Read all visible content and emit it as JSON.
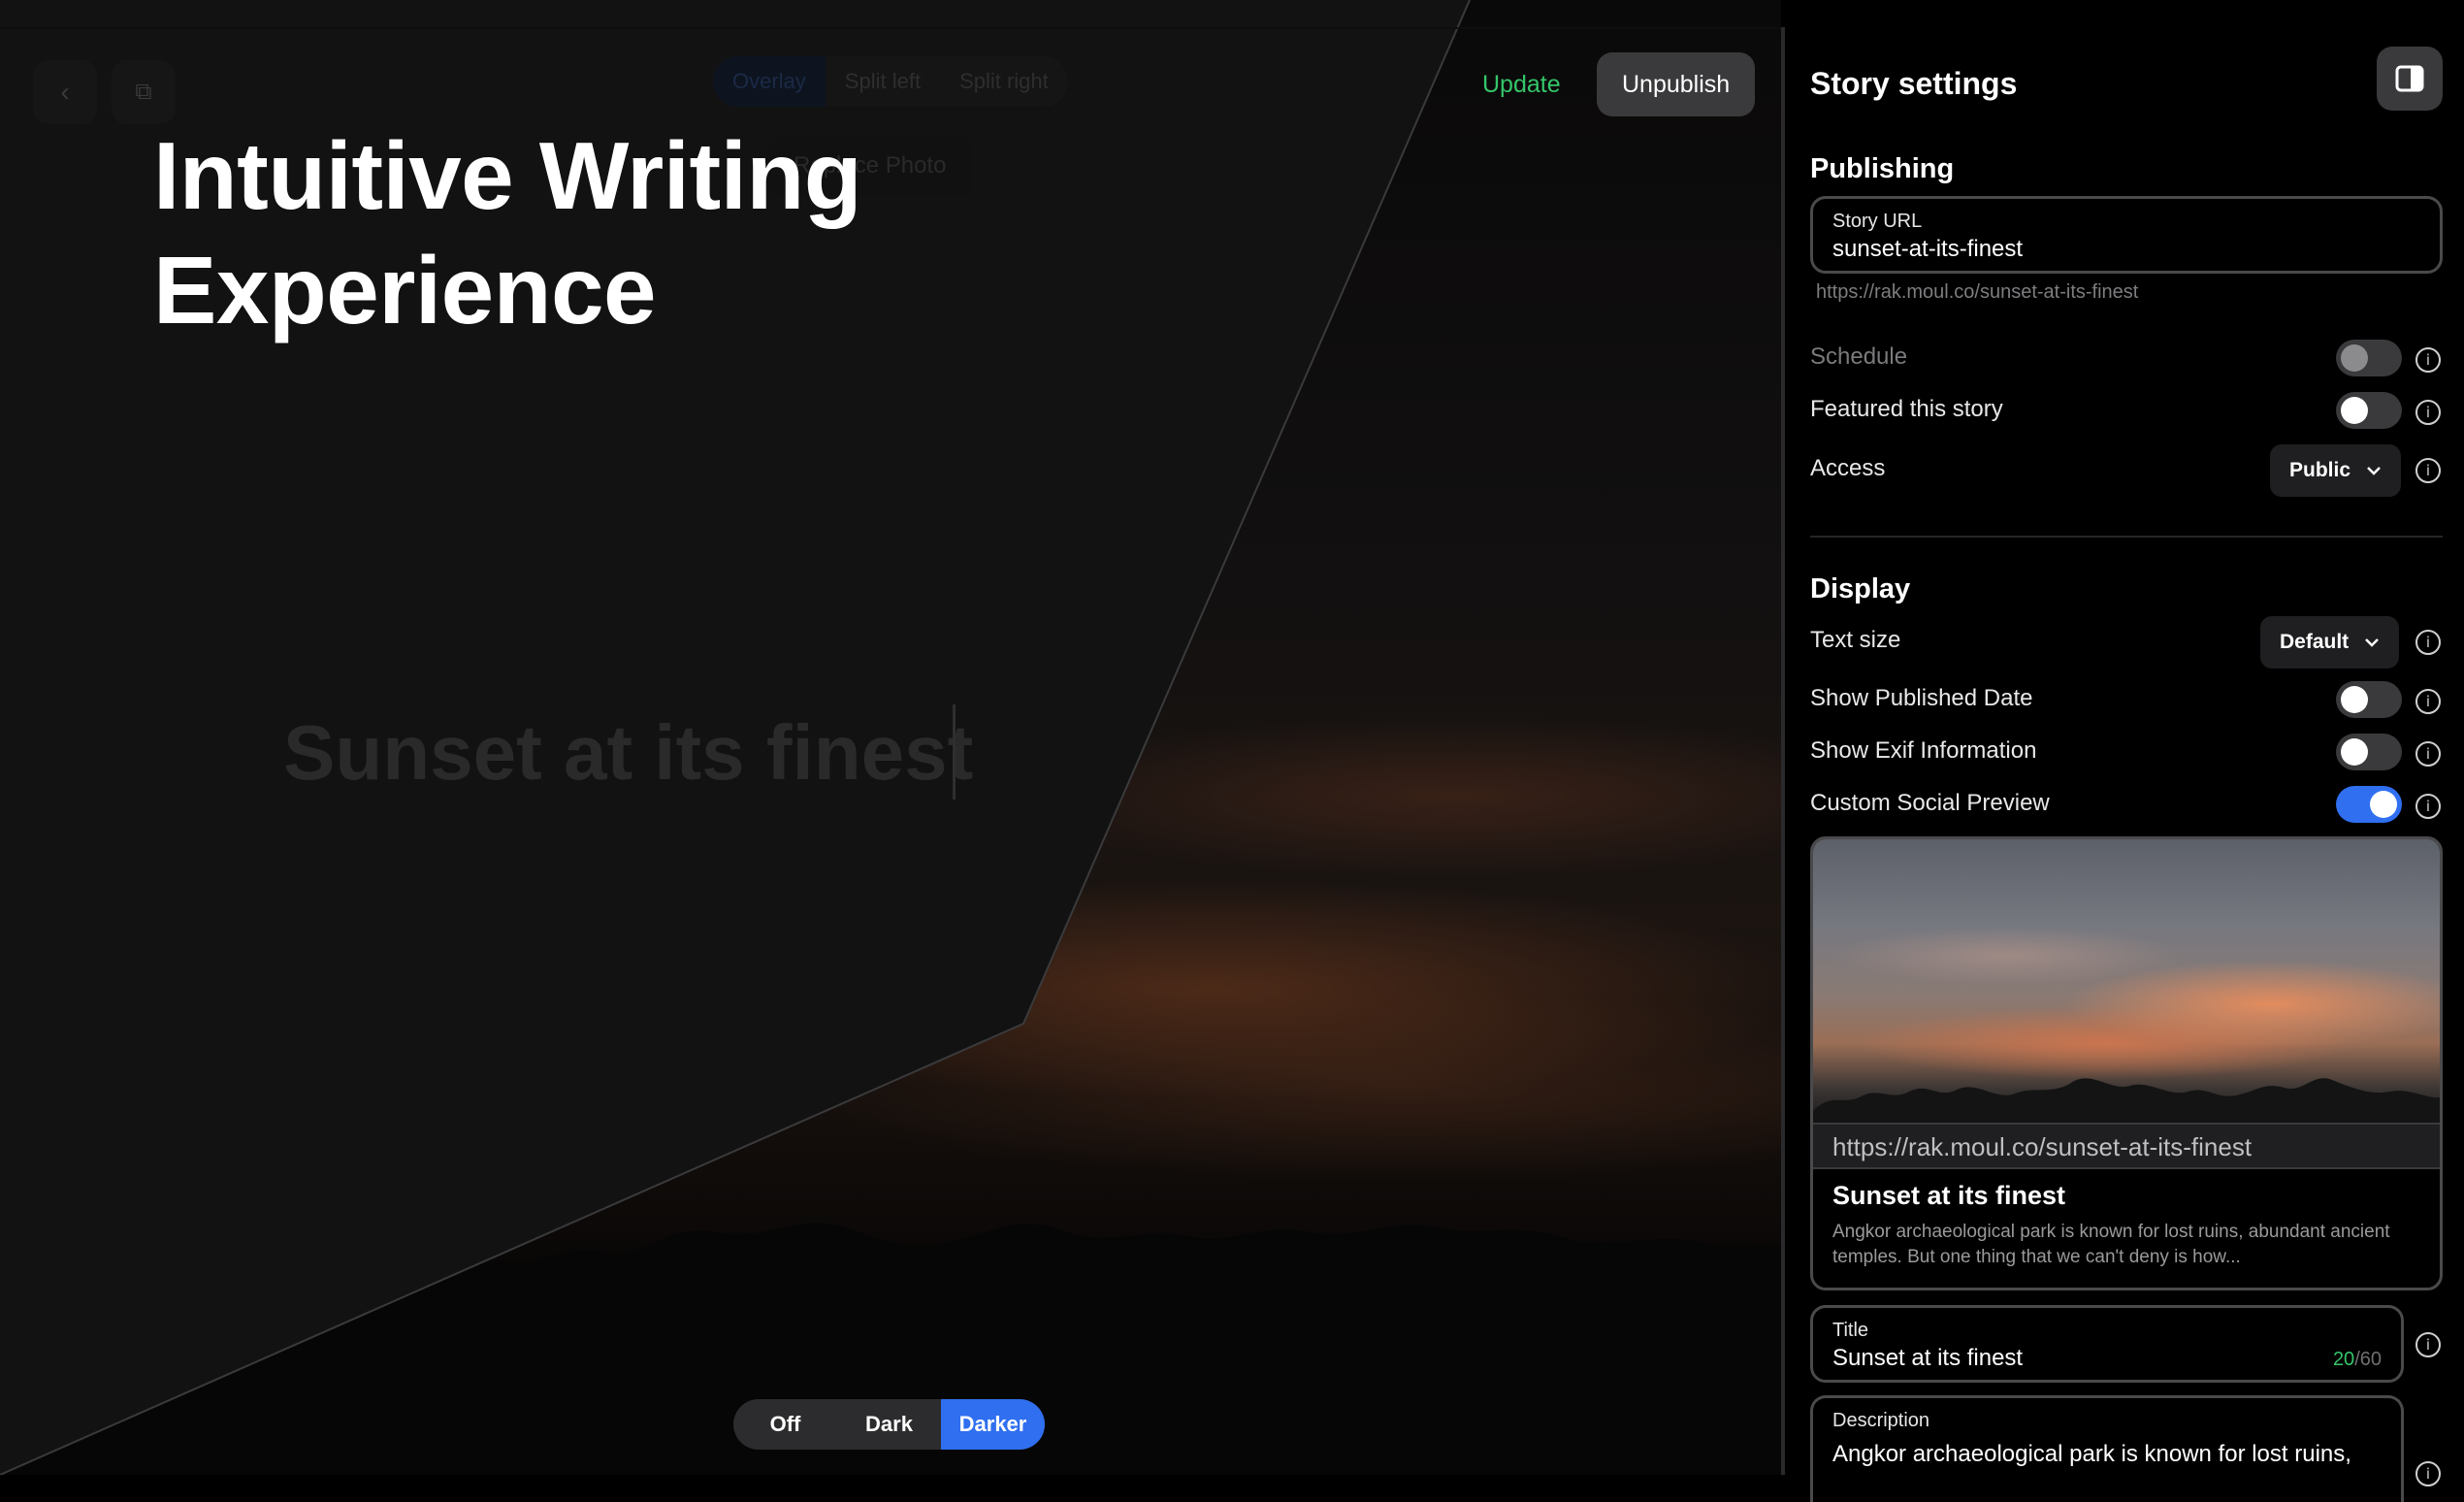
{
  "editor": {
    "layout_options": [
      "Overlay",
      "Split left",
      "Split right"
    ],
    "replace_photo_label": "Replace Photo",
    "hero_title_line1": "Intuitive Writing",
    "hero_title_line2": "Experience",
    "story_title": "Sunset at its finest",
    "update_label": "Update",
    "unpublish_label": "Unpublish",
    "dim_options": [
      "Off",
      "Dark",
      "Darker"
    ],
    "dim_selected": "Darker"
  },
  "settings": {
    "title": "Story settings",
    "publishing": {
      "heading": "Publishing",
      "url_label": "Story URL",
      "url_value": "sunset-at-its-finest",
      "url_hint": "https://rak.moul.co/sunset-at-its-finest",
      "schedule_label": "Schedule",
      "featured_label": "Featured this story",
      "access_label": "Access",
      "access_value": "Public"
    },
    "display": {
      "heading": "Display",
      "text_size_label": "Text size",
      "text_size_value": "Default",
      "published_date_label": "Show Published Date",
      "exif_label": "Show Exif Information",
      "social_preview_label": "Custom Social Preview"
    },
    "social_preview": {
      "url": "https://rak.moul.co/sunset-at-its-finest",
      "title": "Sunset at its finest",
      "description": "Angkor archaeological park is known for lost ruins, abundant ancient temples. But one thing that we can't deny is how..."
    },
    "title_field": {
      "label": "Title",
      "value": "Sunset at its finest",
      "count": "20",
      "max": "/60"
    },
    "description_field": {
      "label": "Description",
      "value": "Angkor archaeological park is known for lost ruins,"
    },
    "toggles": {
      "schedule": false,
      "featured": false,
      "published_date": false,
      "exif": false,
      "social_preview": true
    }
  },
  "colors": {
    "accent_blue": "#2f6ff0",
    "update_green": "#35c66a",
    "panel_bg": "#000000",
    "overlay_bg": "#121212"
  }
}
